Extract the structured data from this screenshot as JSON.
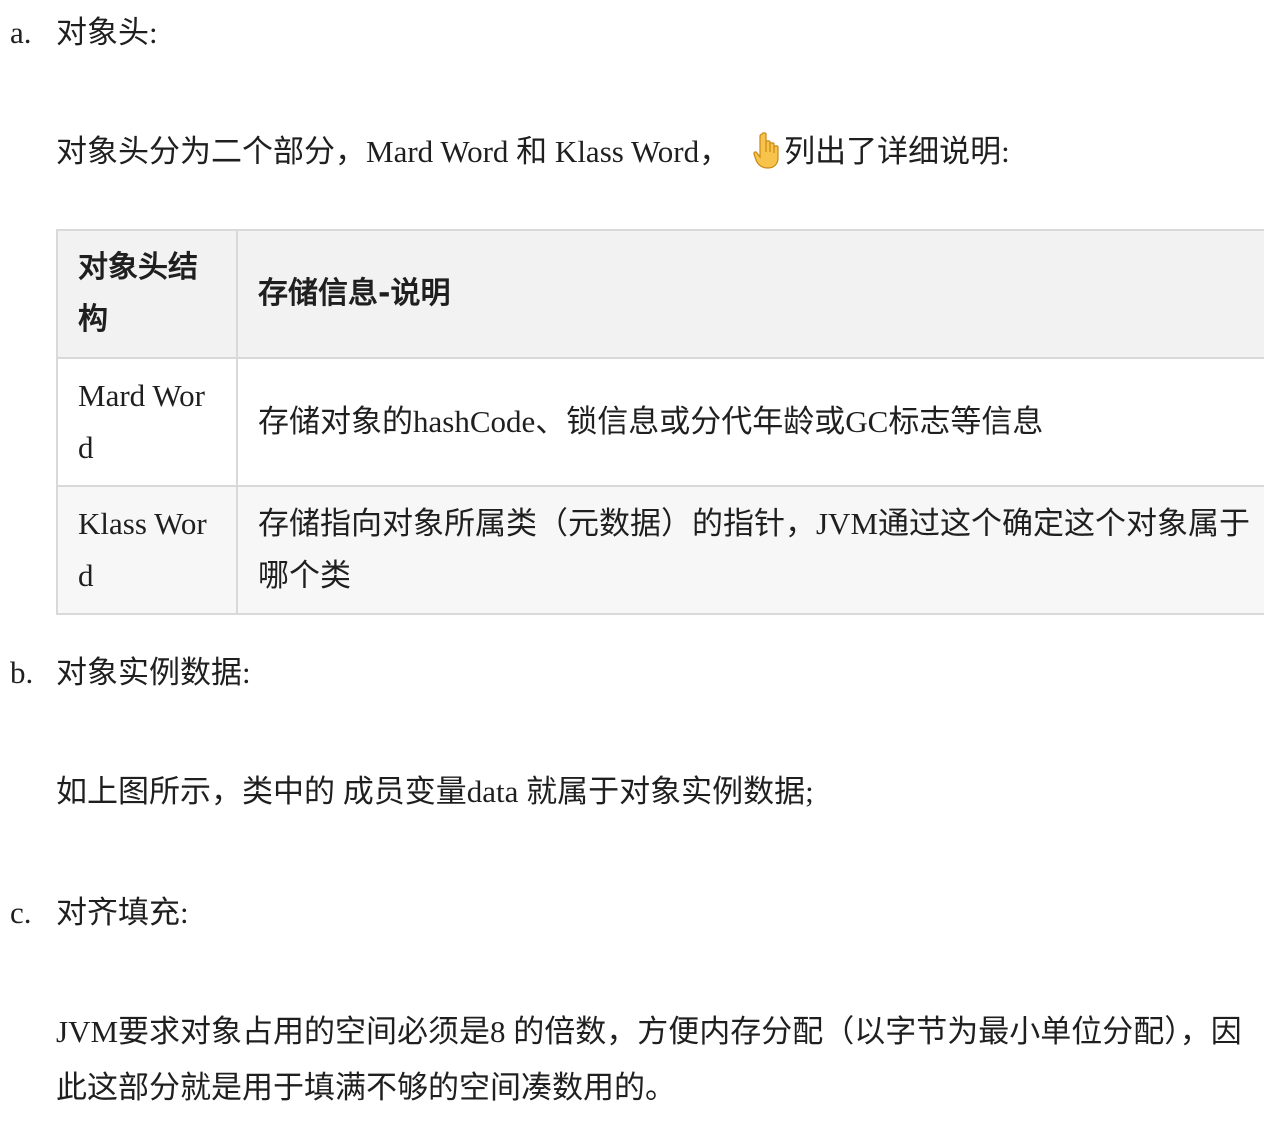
{
  "sections": {
    "a": {
      "marker": "a.",
      "title": "对象头:",
      "desc_before": "对象头分为二个部分，Mard Word 和 Klass Word，",
      "emoji": "👇",
      "desc_after": "列出了详细说明:",
      "table": {
        "headers": [
          "对象头结构",
          "存储信息-说明"
        ],
        "rows": [
          [
            "Mard Word",
            "存储对象的hashCode、锁信息或分代年龄或GC标志等信息"
          ],
          [
            "Klass Word",
            "存储指向对象所属类（元数据）的指针，JVM通过这个确定这个对象属于哪个类"
          ]
        ]
      }
    },
    "b": {
      "marker": "b.",
      "title": "对象实例数据:",
      "desc": "如上图所示，类中的 成员变量data 就属于对象实例数据;"
    },
    "c": {
      "marker": "c.",
      "title": "对齐填充:",
      "desc": "JVM要求对象占用的空间必须是8 的倍数，方便内存分配（以字节为最小单位分配），因此这部分就是用于填满不够的空间凑数用的。"
    }
  }
}
